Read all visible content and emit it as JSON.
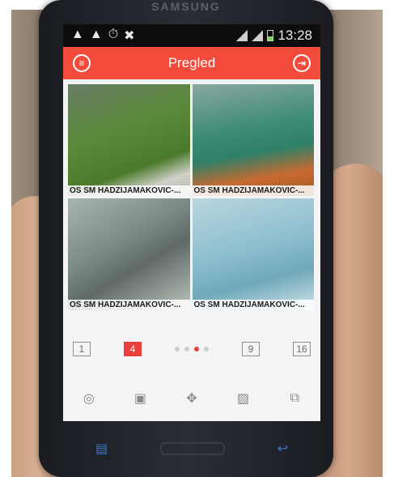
{
  "phone": {
    "brand": "SAMSUNG"
  },
  "statusbar": {
    "left_icons": [
      "▲",
      "▲",
      "⏱",
      "✖"
    ],
    "time": "13:28"
  },
  "appbar": {
    "title": "Pregled",
    "left_icon": "menu-icon",
    "right_icon": "exit-icon",
    "left_glyph": "≡",
    "right_glyph": "⇥"
  },
  "cameras": [
    {
      "label": "OS SM HADZIJAMAKOVIC-..."
    },
    {
      "label": "OS SM HADZIJAMAKOVIC-..."
    },
    {
      "label": "OS SM HADZIJAMAKOVIC-..."
    },
    {
      "label": "OS SM HADZIJAMAKOVIC-..."
    }
  ],
  "layouts": {
    "one": "1",
    "four": "4",
    "nine": "9",
    "sixteen": "16"
  },
  "toolbar": {
    "capture_glyph": "◎",
    "record_glyph": "▣",
    "ptz_glyph": "✥",
    "image_glyph": "▨",
    "playback_glyph": "⧉"
  },
  "colors": {
    "accent": "#f24a3b"
  }
}
